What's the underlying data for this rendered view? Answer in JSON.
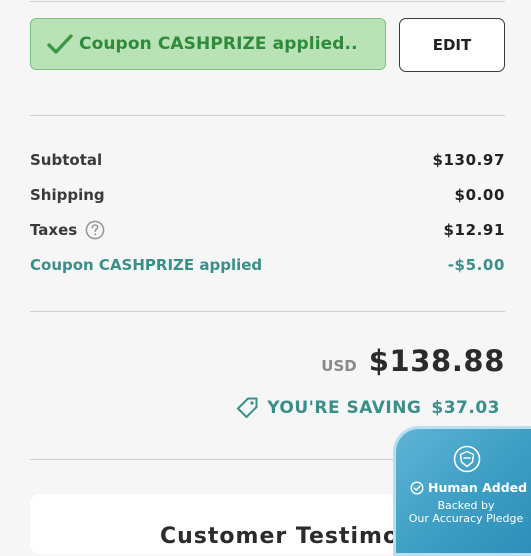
{
  "coupon_banner": {
    "text": "Coupon CASHPRIZE applied..",
    "icon": "checkmark-icon"
  },
  "edit_button": {
    "label": "EDIT"
  },
  "summary": {
    "subtotal": {
      "label": "Subtotal",
      "value": "$130.97"
    },
    "shipping": {
      "label": "Shipping",
      "value": "$0.00"
    },
    "taxes": {
      "label": "Taxes",
      "value": "$12.91",
      "icon": "help-icon"
    },
    "coupon": {
      "label": "Coupon CASHPRIZE applied",
      "value": "-$5.00"
    }
  },
  "total": {
    "currency": "USD",
    "amount": "$138.88"
  },
  "saving": {
    "label": "YOU'RE SAVING",
    "amount": "$37.03",
    "icon": "price-tag-icon"
  },
  "section": {
    "title": "Customer Testimonials"
  },
  "badge": {
    "title": "Human Added",
    "subtitle_line1": "Backed by",
    "subtitle_line2": "Our Accuracy Pledge"
  },
  "colors": {
    "coupon_bg": "#b9e3b6",
    "coupon_text": "#2f8a39",
    "teal_accent": "#3a8f89",
    "badge_blue": "#3b9dc2"
  }
}
